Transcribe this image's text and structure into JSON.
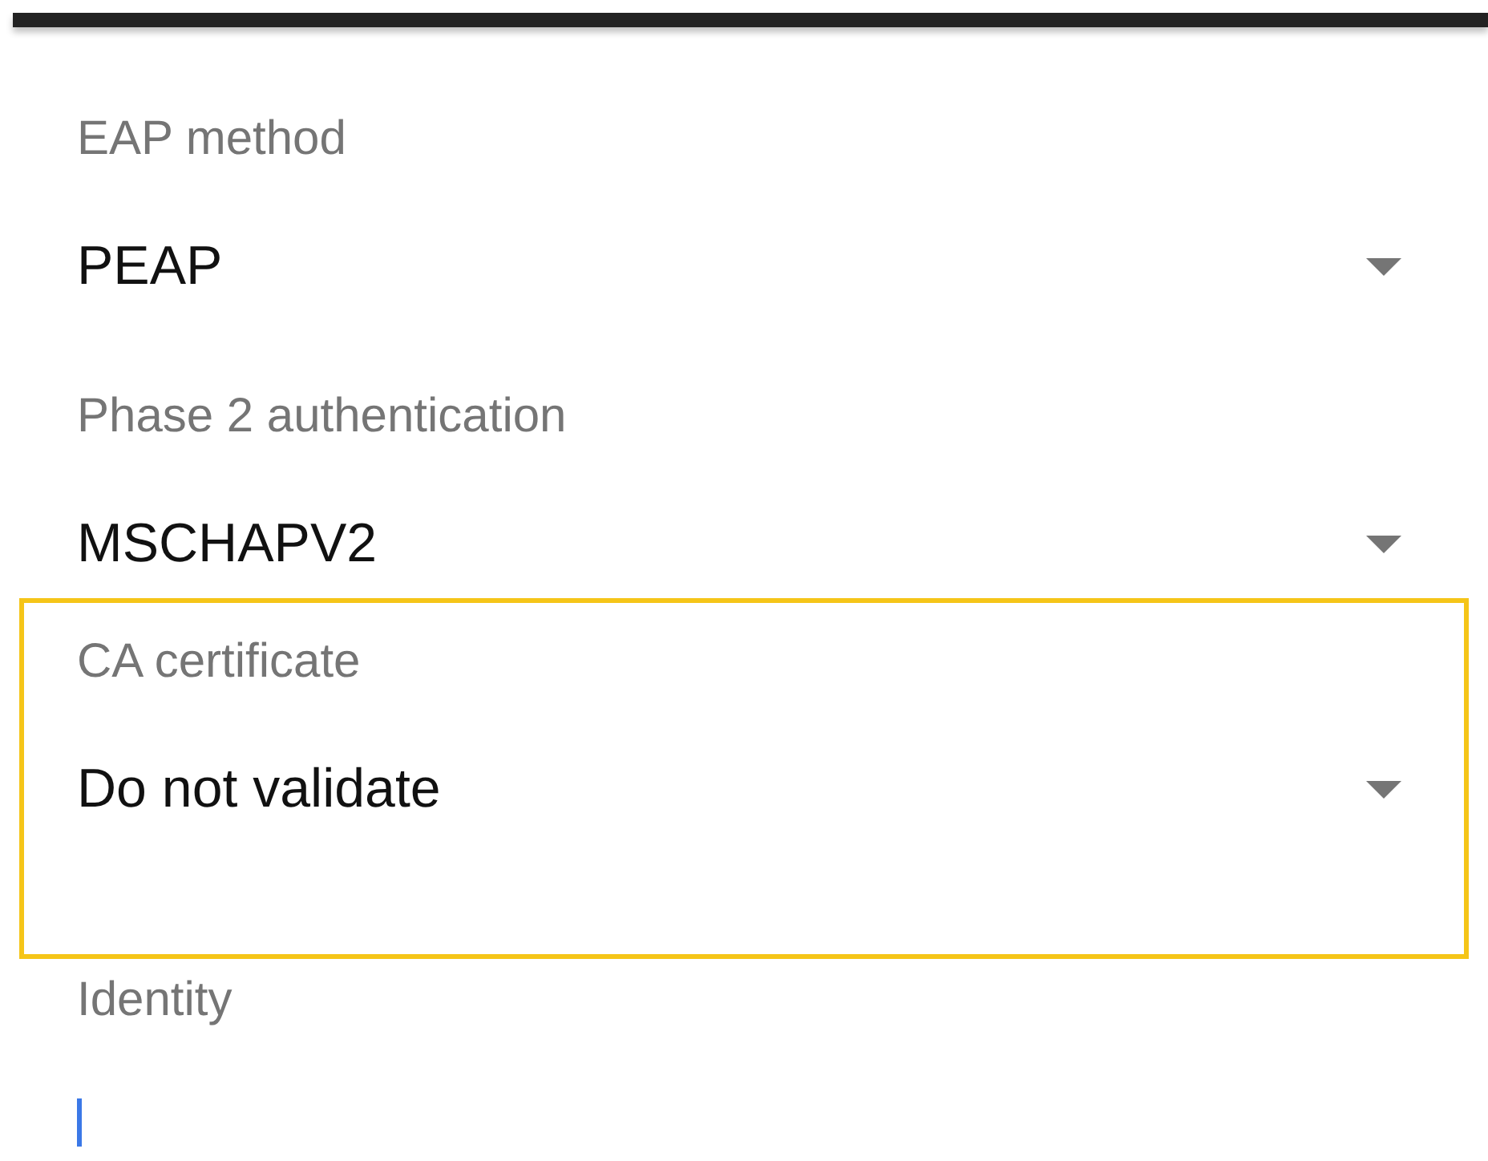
{
  "fields": [
    {
      "kind": "dropdown",
      "label": "EAP method",
      "value": "PEAP",
      "highlighted": false
    },
    {
      "kind": "dropdown",
      "label": "Phase 2 authentication",
      "value": "MSCHAPV2",
      "highlighted": false
    },
    {
      "kind": "dropdown",
      "label": "CA certificate",
      "value": "Do not validate",
      "highlighted": true
    },
    {
      "kind": "text",
      "label": "Identity",
      "highlighted": false
    }
  ]
}
